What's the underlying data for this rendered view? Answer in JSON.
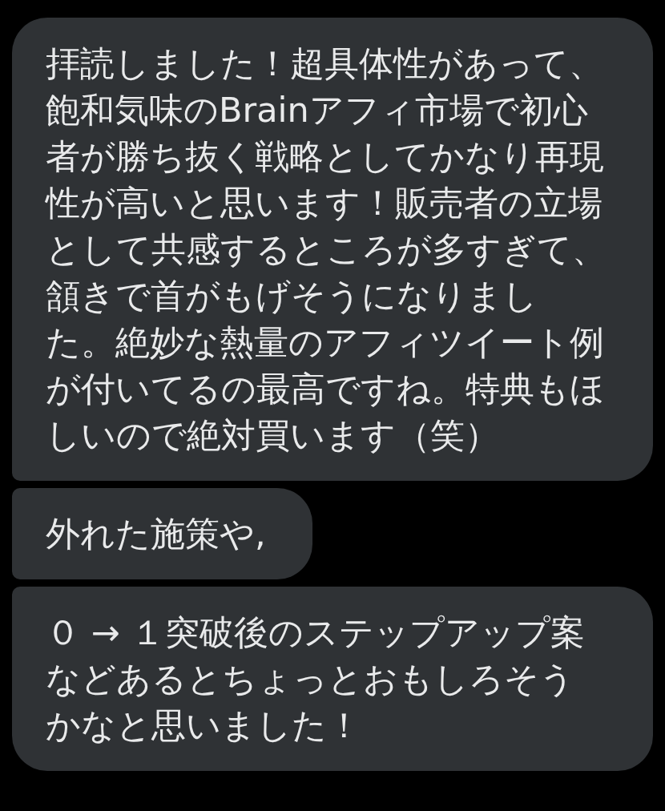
{
  "messages": [
    {
      "text": "拝読しました！超具体性があって、飽和気味のBrainアフィ市場で初心者が勝ち抜く戦略としてかなり再現性が高いと思います！販売者の立場として共感するところが多すぎて、頷きで首がもげそうになりました。絶妙な熱量のアフィツイート例が付いてるの最高ですね。特典もほしいので絶対買います（笑）"
    },
    {
      "text": "外れた施策や,"
    },
    {
      "text": "０ → １突破後のステップアップ案などあるとちょっとおもしろそうかなと思いました！"
    }
  ]
}
